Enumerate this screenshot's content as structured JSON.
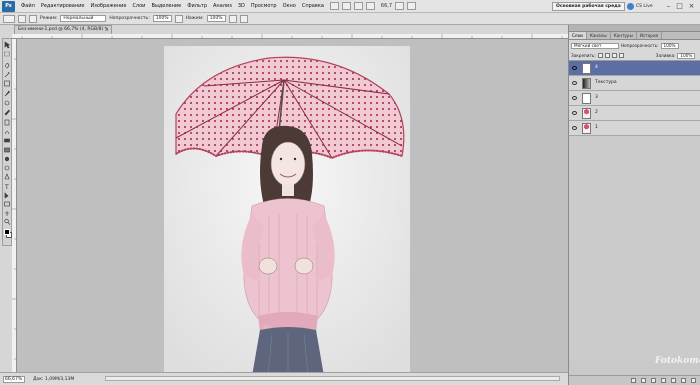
{
  "menubar": {
    "logo": "Ps",
    "items": [
      "Файл",
      "Редактирование",
      "Изображение",
      "Слои",
      "Выделение",
      "Фильтр",
      "Анализ",
      "3D",
      "Просмотр",
      "Окно",
      "Справка"
    ],
    "zoom": "66,7",
    "workspace": "Основная рабочая среда",
    "live": "CS Live",
    "window_buttons": [
      "–",
      "□",
      "×"
    ]
  },
  "options": {
    "mode_label": "Режим:",
    "mode_value": "Нормальный",
    "opacity_label": "Непрозрачность:",
    "opacity_value": "100%",
    "flow_label": "Нажим:",
    "flow_value": "100%"
  },
  "document": {
    "tab_title": "Без-имени-1.psd @ 66,7% (4, RGB/8) *",
    "close": "×"
  },
  "status": {
    "zoom": "66,67%",
    "doc_info": "Док: 1,09M/3,13M"
  },
  "layers_panel": {
    "tabs": [
      "Слои",
      "Каналы",
      "Контуры",
      "История"
    ],
    "blend_mode": "Мягкий свет",
    "opacity_label": "Непрозрачность:",
    "opacity_value": "100%",
    "lock_label": "Закрепить:",
    "fill_label": "Заливка:",
    "fill_value": "100%",
    "layers": [
      {
        "name": "4",
        "selected": true,
        "thumb": "white"
      },
      {
        "name": "Текстура",
        "selected": false,
        "thumb": "gradient"
      },
      {
        "name": "3",
        "selected": false,
        "thumb": "white"
      },
      {
        "name": "2",
        "selected": false,
        "thumb": "photo"
      },
      {
        "name": "1",
        "selected": false,
        "thumb": "photo"
      }
    ]
  },
  "watermark": "Fotokomok.ru",
  "colors": {
    "selected_layer": "#5b6fa5",
    "umbrella": "#c0506a",
    "shirt": "#e7b5c3",
    "jeans": "#5a6378"
  }
}
